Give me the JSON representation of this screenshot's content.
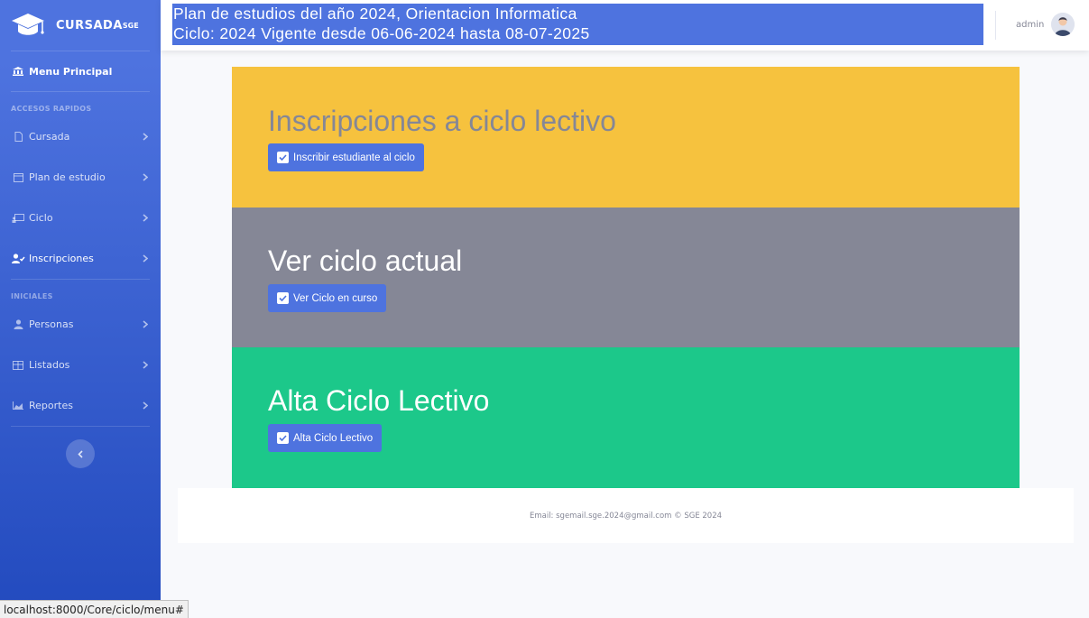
{
  "brand": {
    "name": "CURSADA",
    "sup": "SGE"
  },
  "sidebar": {
    "main_item": "Menu Principal",
    "heading_1": "ACCESOS RAPIDOS",
    "items_1": [
      {
        "label": "Cursada",
        "icon": "file-icon"
      },
      {
        "label": "Plan de estudio",
        "icon": "calendar-icon"
      },
      {
        "label": "Ciclo",
        "icon": "chalkboard-icon"
      },
      {
        "label": "Inscripciones",
        "icon": "user-check-icon"
      }
    ],
    "heading_2": "INICIALES",
    "items_2": [
      {
        "label": "Personas",
        "icon": "user-tie-icon"
      },
      {
        "label": "Listados",
        "icon": "table-icon"
      },
      {
        "label": "Reportes",
        "icon": "chart-area-icon"
      }
    ]
  },
  "topbar": {
    "line1": "Plan de estudios del año 2024, Orientacion Informatica",
    "line2": "Ciclo: 2024 Vigente desde 06-06-2024 hasta 08-07-2025",
    "user_name": "admin"
  },
  "cards": [
    {
      "title": "Inscripciones a ciclo lectivo",
      "button": "Inscribir estudiante al ciclo",
      "color": "#f6c23e"
    },
    {
      "title": "Ver ciclo actual",
      "button": "Ver Ciclo en curso",
      "color": "#858796"
    },
    {
      "title": "Alta Ciclo Lectivo",
      "button": "Alta Ciclo Lectivo",
      "color": "#1cc88a"
    }
  ],
  "footer": {
    "text": "Email: sgemail.sge.2024@gmail.com © SGE 2024"
  },
  "statusbar": {
    "url": "localhost:8000/Core/ciclo/menu#"
  },
  "colors": {
    "primary": "#4e73df",
    "warning": "#f6c23e",
    "secondary": "#858796",
    "success": "#1cc88a"
  }
}
